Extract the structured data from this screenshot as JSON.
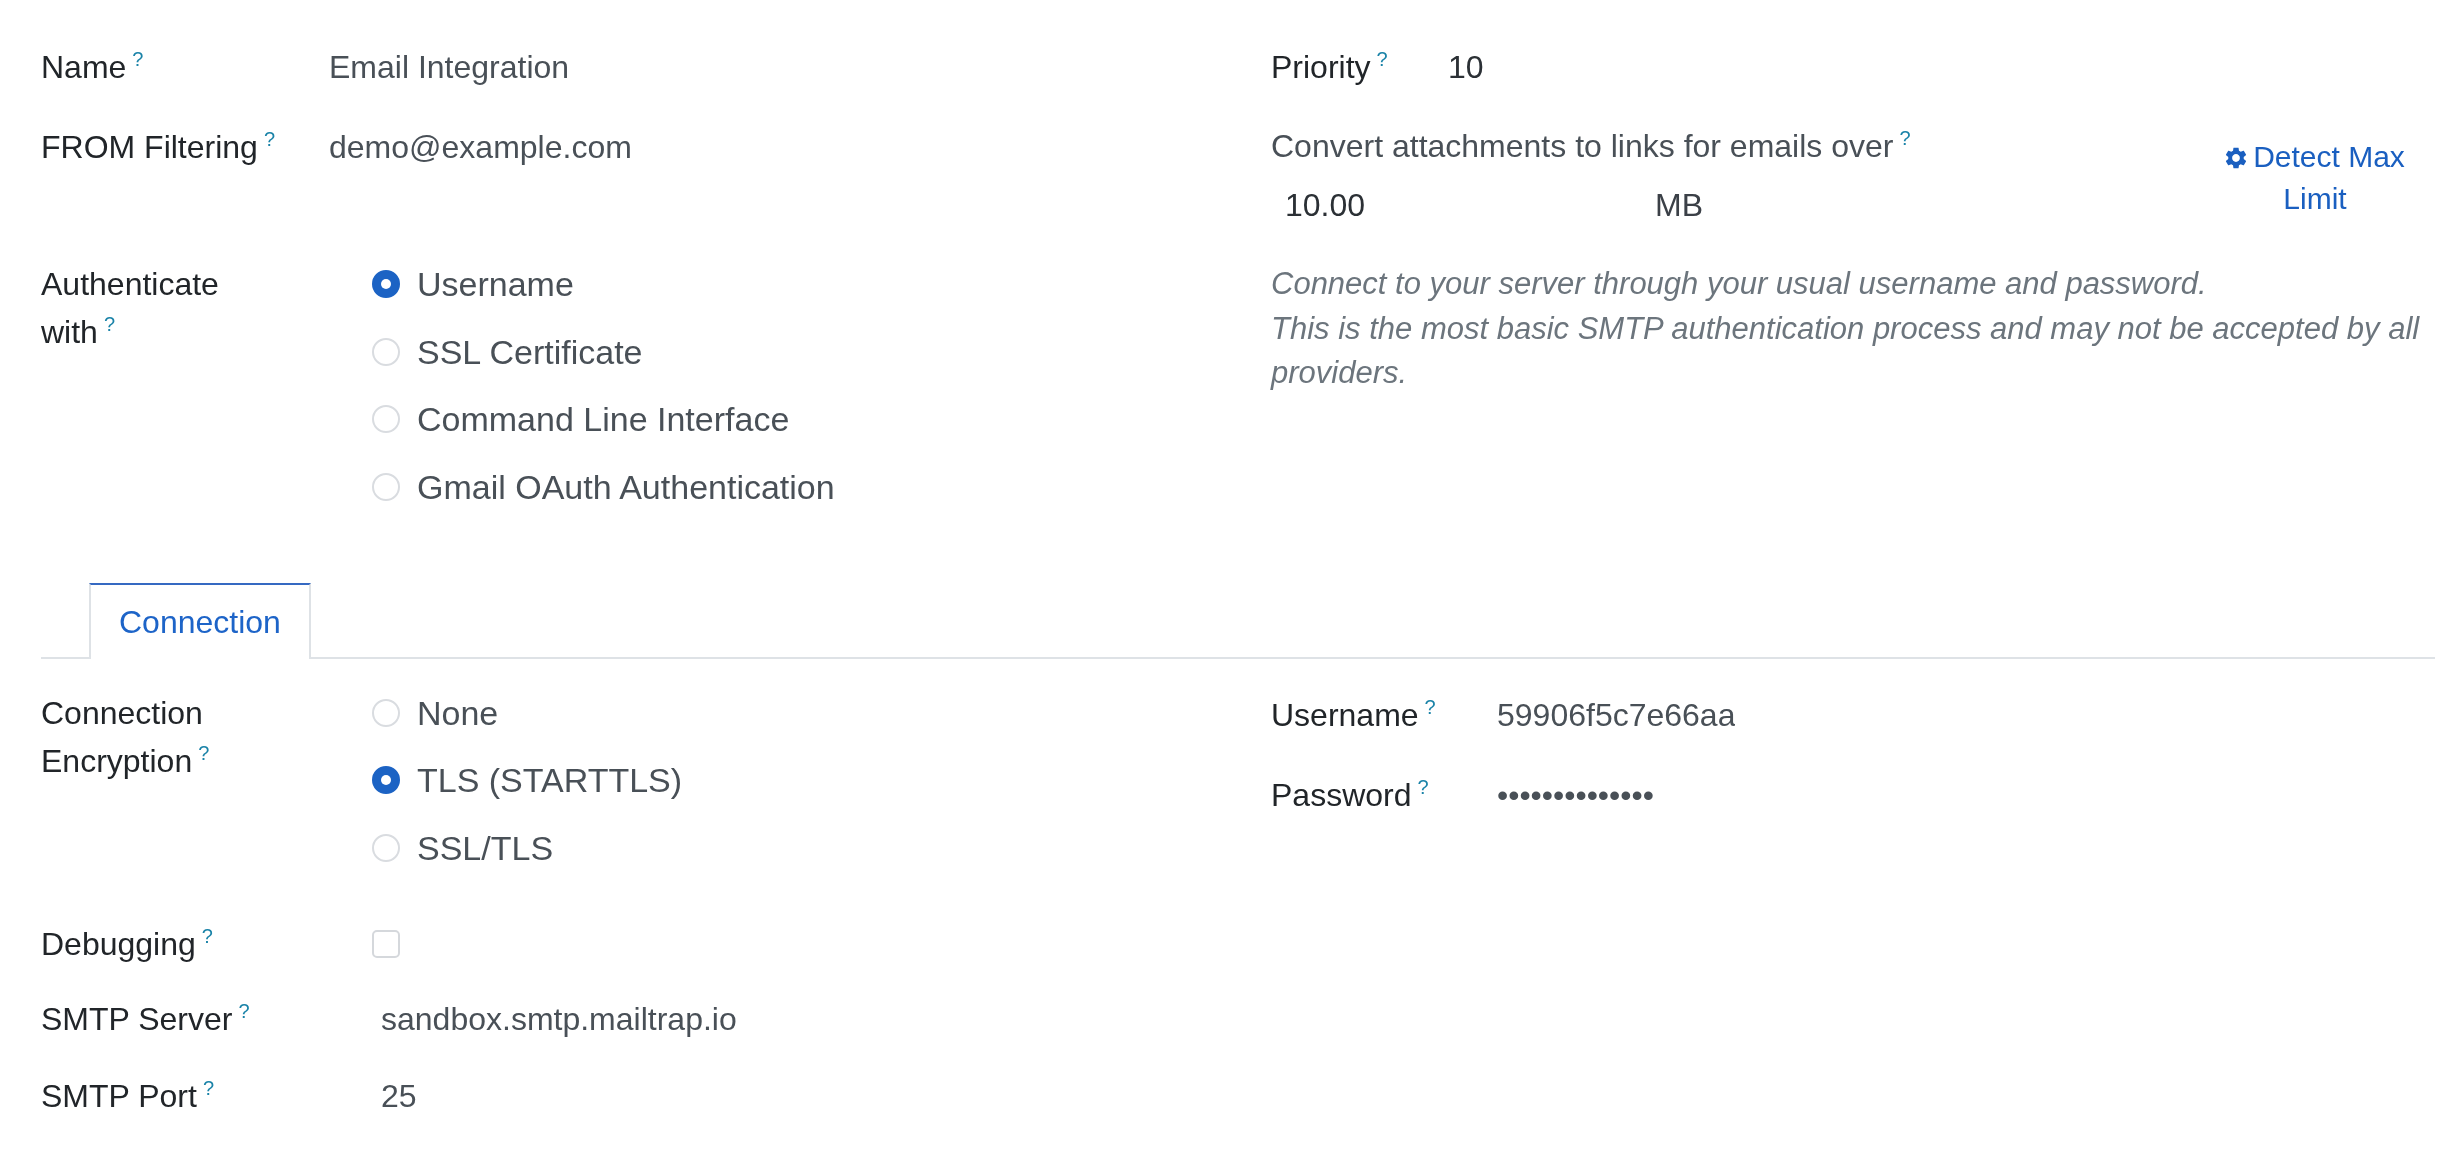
{
  "general": {
    "name": {
      "label": "Name",
      "help": "?",
      "value": "Email Integration"
    },
    "from_filtering": {
      "label": "FROM Filtering",
      "help": "?",
      "value": "demo@example.com"
    },
    "authenticate_with": {
      "label": "Authenticate with",
      "help": "?",
      "options": [
        {
          "label": "Username",
          "selected": true
        },
        {
          "label": "SSL Certificate",
          "selected": false
        },
        {
          "label": "Command Line Interface",
          "selected": false
        },
        {
          "label": "Gmail OAuth Authentication",
          "selected": false
        }
      ]
    },
    "priority": {
      "label": "Priority",
      "help": "?",
      "value": "10"
    },
    "attachment_limit": {
      "label": "Convert attachments to links for emails over",
      "help": "?",
      "value": "10.00",
      "unit": "MB",
      "button": "Detect Max Limit"
    },
    "auth_description": "Connect to your server through your usual username and password.\nThis is the most basic SMTP authentication process and may not be accepted by all providers."
  },
  "tabs": [
    {
      "label": "Connection",
      "selected": true
    }
  ],
  "connection": {
    "encryption": {
      "label": "Connection Encryption",
      "help": "?",
      "options": [
        {
          "label": "None",
          "selected": false
        },
        {
          "label": "TLS (STARTTLS)",
          "selected": true
        },
        {
          "label": "SSL/TLS",
          "selected": false
        }
      ]
    },
    "username": {
      "label": "Username",
      "help": "?",
      "value": "59906f5c7e66aa"
    },
    "password": {
      "label": "Password",
      "help": "?",
      "value": "••••••••••••••"
    },
    "debugging": {
      "label": "Debugging",
      "help": "?",
      "checked": false
    },
    "smtp_server": {
      "label": "SMTP Server",
      "help": "?",
      "value": "sandbox.smtp.mailtrap.io"
    },
    "smtp_port": {
      "label": "SMTP Port",
      "help": "?",
      "value": "25"
    }
  }
}
